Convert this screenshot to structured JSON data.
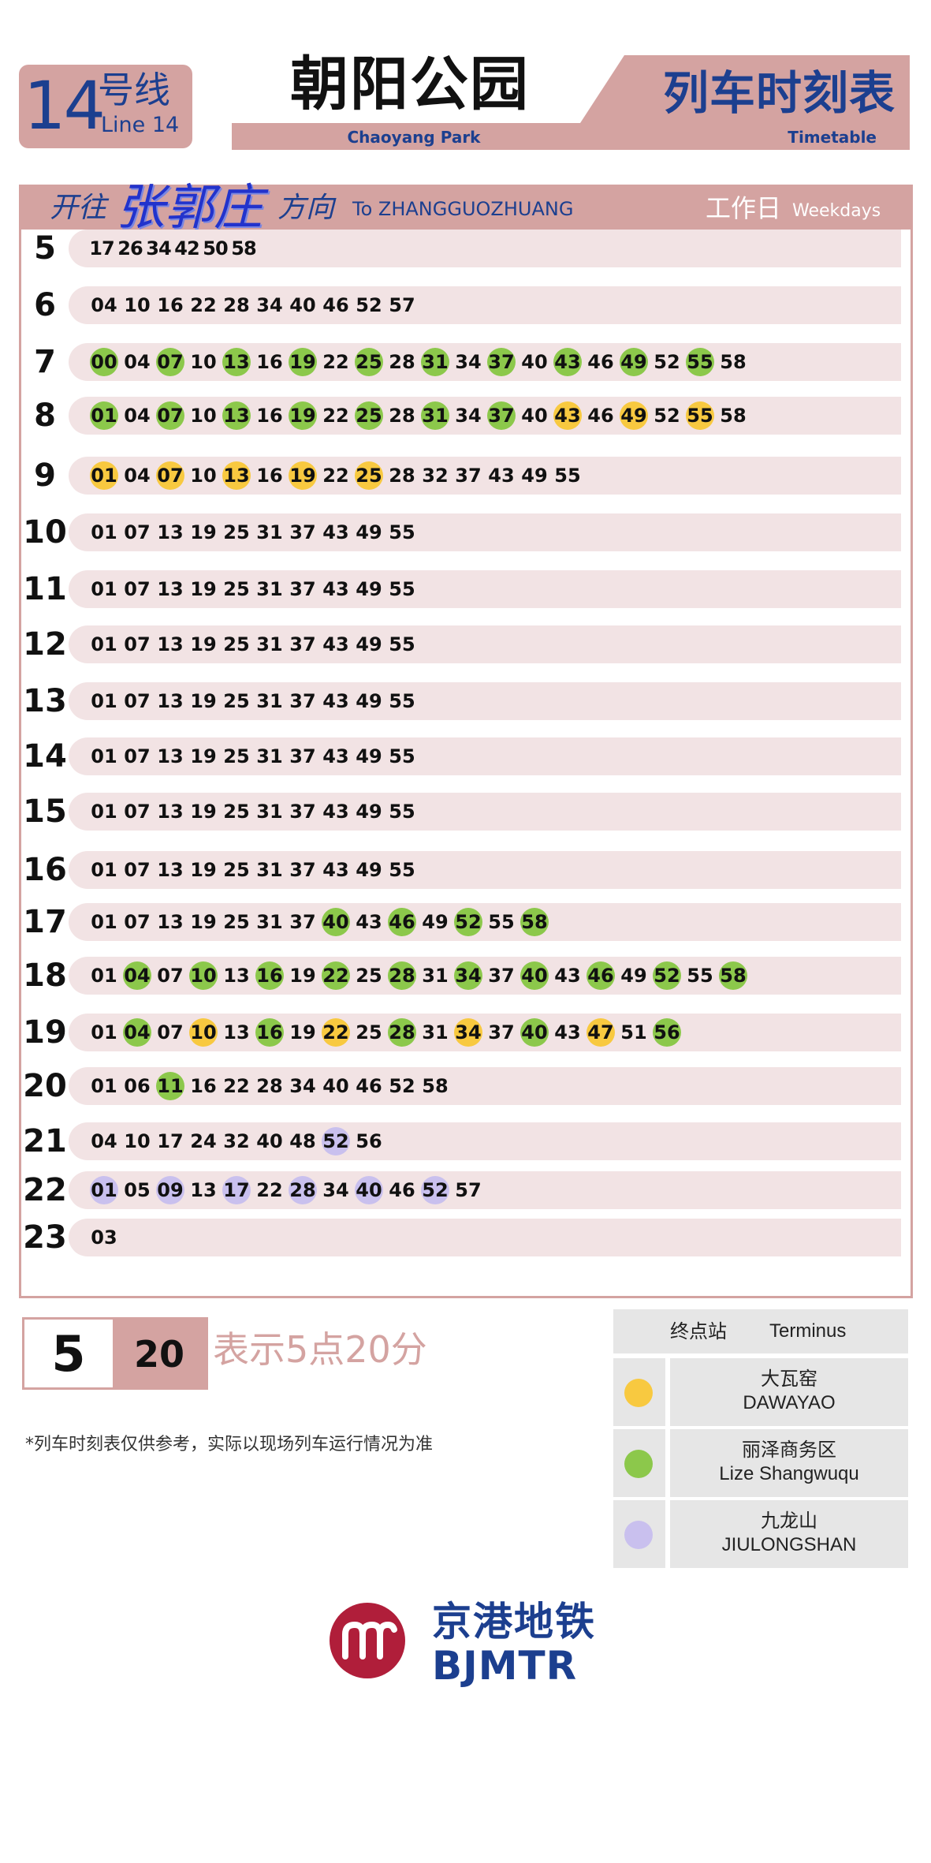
{
  "header": {
    "line_number": "14",
    "line_cn": "号线",
    "line_en": "Line 14",
    "station_cn": "朝阳公园",
    "station_en": "Chaoyang Park",
    "title_cn": "列车时刻表",
    "title_en": "Timetable"
  },
  "direction": {
    "prefix_cn": "开往",
    "destination_cn": "张郭庄",
    "suffix_cn": "方向",
    "to_en": "To ZHANGGUOZHUANG",
    "day_cn": "工作日",
    "day_en": "Weekdays"
  },
  "timetable": [
    {
      "hour": "5",
      "minutes": [
        [
          "17",
          ""
        ],
        [
          "26",
          ""
        ],
        [
          "34",
          ""
        ],
        [
          "42",
          ""
        ],
        [
          "50",
          ""
        ],
        [
          "58",
          ""
        ]
      ]
    },
    {
      "hour": "6",
      "minutes": [
        [
          "04",
          ""
        ],
        [
          "10",
          ""
        ],
        [
          "16",
          ""
        ],
        [
          "22",
          ""
        ],
        [
          "28",
          ""
        ],
        [
          "34",
          ""
        ],
        [
          "40",
          ""
        ],
        [
          "46",
          ""
        ],
        [
          "52",
          ""
        ],
        [
          "57",
          ""
        ]
      ]
    },
    {
      "hour": "7",
      "minutes": [
        [
          "00",
          "g"
        ],
        [
          "04",
          ""
        ],
        [
          "07",
          "g"
        ],
        [
          "10",
          ""
        ],
        [
          "13",
          "g"
        ],
        [
          "16",
          ""
        ],
        [
          "19",
          "g"
        ],
        [
          "22",
          ""
        ],
        [
          "25",
          "g"
        ],
        [
          "28",
          ""
        ],
        [
          "31",
          "g"
        ],
        [
          "34",
          ""
        ],
        [
          "37",
          "g"
        ],
        [
          "40",
          ""
        ],
        [
          "43",
          "g"
        ],
        [
          "46",
          ""
        ],
        [
          "49",
          "g"
        ],
        [
          "52",
          ""
        ],
        [
          "55",
          "g"
        ],
        [
          "58",
          ""
        ]
      ]
    },
    {
      "hour": "8",
      "minutes": [
        [
          "01",
          "g"
        ],
        [
          "04",
          ""
        ],
        [
          "07",
          "g"
        ],
        [
          "10",
          ""
        ],
        [
          "13",
          "g"
        ],
        [
          "16",
          ""
        ],
        [
          "19",
          "g"
        ],
        [
          "22",
          ""
        ],
        [
          "25",
          "g"
        ],
        [
          "28",
          ""
        ],
        [
          "31",
          "g"
        ],
        [
          "34",
          ""
        ],
        [
          "37",
          "g"
        ],
        [
          "40",
          ""
        ],
        [
          "43",
          "y"
        ],
        [
          "46",
          ""
        ],
        [
          "49",
          "y"
        ],
        [
          "52",
          ""
        ],
        [
          "55",
          "y"
        ],
        [
          "58",
          ""
        ]
      ]
    },
    {
      "hour": "9",
      "minutes": [
        [
          "01",
          "y"
        ],
        [
          "04",
          ""
        ],
        [
          "07",
          "y"
        ],
        [
          "10",
          ""
        ],
        [
          "13",
          "y"
        ],
        [
          "16",
          ""
        ],
        [
          "19",
          "y"
        ],
        [
          "22",
          ""
        ],
        [
          "25",
          "y"
        ],
        [
          "28",
          ""
        ],
        [
          "32",
          ""
        ],
        [
          "37",
          ""
        ],
        [
          "43",
          ""
        ],
        [
          "49",
          ""
        ],
        [
          "55",
          ""
        ]
      ]
    },
    {
      "hour": "10",
      "minutes": [
        [
          "01",
          ""
        ],
        [
          "07",
          ""
        ],
        [
          "13",
          ""
        ],
        [
          "19",
          ""
        ],
        [
          "25",
          ""
        ],
        [
          "31",
          ""
        ],
        [
          "37",
          ""
        ],
        [
          "43",
          ""
        ],
        [
          "49",
          ""
        ],
        [
          "55",
          ""
        ]
      ]
    },
    {
      "hour": "11",
      "minutes": [
        [
          "01",
          ""
        ],
        [
          "07",
          ""
        ],
        [
          "13",
          ""
        ],
        [
          "19",
          ""
        ],
        [
          "25",
          ""
        ],
        [
          "31",
          ""
        ],
        [
          "37",
          ""
        ],
        [
          "43",
          ""
        ],
        [
          "49",
          ""
        ],
        [
          "55",
          ""
        ]
      ]
    },
    {
      "hour": "12",
      "minutes": [
        [
          "01",
          ""
        ],
        [
          "07",
          ""
        ],
        [
          "13",
          ""
        ],
        [
          "19",
          ""
        ],
        [
          "25",
          ""
        ],
        [
          "31",
          ""
        ],
        [
          "37",
          ""
        ],
        [
          "43",
          ""
        ],
        [
          "49",
          ""
        ],
        [
          "55",
          ""
        ]
      ]
    },
    {
      "hour": "13",
      "minutes": [
        [
          "01",
          ""
        ],
        [
          "07",
          ""
        ],
        [
          "13",
          ""
        ],
        [
          "19",
          ""
        ],
        [
          "25",
          ""
        ],
        [
          "31",
          ""
        ],
        [
          "37",
          ""
        ],
        [
          "43",
          ""
        ],
        [
          "49",
          ""
        ],
        [
          "55",
          ""
        ]
      ]
    },
    {
      "hour": "14",
      "minutes": [
        [
          "01",
          ""
        ],
        [
          "07",
          ""
        ],
        [
          "13",
          ""
        ],
        [
          "19",
          ""
        ],
        [
          "25",
          ""
        ],
        [
          "31",
          ""
        ],
        [
          "37",
          ""
        ],
        [
          "43",
          ""
        ],
        [
          "49",
          ""
        ],
        [
          "55",
          ""
        ]
      ]
    },
    {
      "hour": "15",
      "minutes": [
        [
          "01",
          ""
        ],
        [
          "07",
          ""
        ],
        [
          "13",
          ""
        ],
        [
          "19",
          ""
        ],
        [
          "25",
          ""
        ],
        [
          "31",
          ""
        ],
        [
          "37",
          ""
        ],
        [
          "43",
          ""
        ],
        [
          "49",
          ""
        ],
        [
          "55",
          ""
        ]
      ]
    },
    {
      "hour": "16",
      "minutes": [
        [
          "01",
          ""
        ],
        [
          "07",
          ""
        ],
        [
          "13",
          ""
        ],
        [
          "19",
          ""
        ],
        [
          "25",
          ""
        ],
        [
          "31",
          ""
        ],
        [
          "37",
          ""
        ],
        [
          "43",
          ""
        ],
        [
          "49",
          ""
        ],
        [
          "55",
          ""
        ]
      ]
    },
    {
      "hour": "17",
      "minutes": [
        [
          "01",
          ""
        ],
        [
          "07",
          ""
        ],
        [
          "13",
          ""
        ],
        [
          "19",
          ""
        ],
        [
          "25",
          ""
        ],
        [
          "31",
          ""
        ],
        [
          "37",
          ""
        ],
        [
          "40",
          "g"
        ],
        [
          "43",
          ""
        ],
        [
          "46",
          "g"
        ],
        [
          "49",
          ""
        ],
        [
          "52",
          "g"
        ],
        [
          "55",
          ""
        ],
        [
          "58",
          "g"
        ]
      ]
    },
    {
      "hour": "18",
      "minutes": [
        [
          "01",
          ""
        ],
        [
          "04",
          "g"
        ],
        [
          "07",
          ""
        ],
        [
          "10",
          "g"
        ],
        [
          "13",
          ""
        ],
        [
          "16",
          "g"
        ],
        [
          "19",
          ""
        ],
        [
          "22",
          "g"
        ],
        [
          "25",
          ""
        ],
        [
          "28",
          "g"
        ],
        [
          "31",
          ""
        ],
        [
          "34",
          "g"
        ],
        [
          "37",
          ""
        ],
        [
          "40",
          "g"
        ],
        [
          "43",
          ""
        ],
        [
          "46",
          "g"
        ],
        [
          "49",
          ""
        ],
        [
          "52",
          "g"
        ],
        [
          "55",
          ""
        ],
        [
          "58",
          "g"
        ]
      ]
    },
    {
      "hour": "19",
      "minutes": [
        [
          "01",
          ""
        ],
        [
          "04",
          "g"
        ],
        [
          "07",
          ""
        ],
        [
          "10",
          "y"
        ],
        [
          "13",
          ""
        ],
        [
          "16",
          "g"
        ],
        [
          "19",
          ""
        ],
        [
          "22",
          "y"
        ],
        [
          "25",
          ""
        ],
        [
          "28",
          "g"
        ],
        [
          "31",
          ""
        ],
        [
          "34",
          "y"
        ],
        [
          "37",
          ""
        ],
        [
          "40",
          "g"
        ],
        [
          "43",
          ""
        ],
        [
          "47",
          "y"
        ],
        [
          "51",
          ""
        ],
        [
          "56",
          "g"
        ]
      ]
    },
    {
      "hour": "20",
      "minutes": [
        [
          "01",
          ""
        ],
        [
          "06",
          ""
        ],
        [
          "11",
          "g"
        ],
        [
          "16",
          ""
        ],
        [
          "22",
          ""
        ],
        [
          "28",
          ""
        ],
        [
          "34",
          ""
        ],
        [
          "40",
          ""
        ],
        [
          "46",
          ""
        ],
        [
          "52",
          ""
        ],
        [
          "58",
          ""
        ]
      ]
    },
    {
      "hour": "21",
      "minutes": [
        [
          "04",
          ""
        ],
        [
          "10",
          ""
        ],
        [
          "17",
          ""
        ],
        [
          "24",
          ""
        ],
        [
          "32",
          ""
        ],
        [
          "40",
          ""
        ],
        [
          "48",
          ""
        ],
        [
          "52",
          "p"
        ],
        [
          "56",
          ""
        ]
      ]
    },
    {
      "hour": "22",
      "minutes": [
        [
          "01",
          "p"
        ],
        [
          "05",
          ""
        ],
        [
          "09",
          "p"
        ],
        [
          "13",
          ""
        ],
        [
          "17",
          "p"
        ],
        [
          "22",
          ""
        ],
        [
          "28",
          "p"
        ],
        [
          "34",
          ""
        ],
        [
          "40",
          "p"
        ],
        [
          "46",
          ""
        ],
        [
          "52",
          "p"
        ],
        [
          "57",
          ""
        ]
      ]
    },
    {
      "hour": "23",
      "minutes": [
        [
          "03",
          ""
        ]
      ]
    }
  ],
  "legend": {
    "hour": "5",
    "minute": "20",
    "explain": "表示5点20分",
    "note": "*列车时刻表仅供参考，实际以现场列车运行情况为准"
  },
  "terminus": {
    "title_cn": "终点站",
    "title_en": "Terminus",
    "items": [
      {
        "cn": "大瓦窑",
        "en": "DAWAYAO",
        "color": "#f8c940"
      },
      {
        "cn": "丽泽商务区",
        "en": "Lize Shangwuqu",
        "color": "#8cc84b"
      },
      {
        "cn": "九龙山",
        "en": "JIULONGSHAN",
        "color": "#c9c0ee"
      }
    ]
  },
  "brand": {
    "cn": "京港地铁",
    "en": "BJMTR"
  }
}
